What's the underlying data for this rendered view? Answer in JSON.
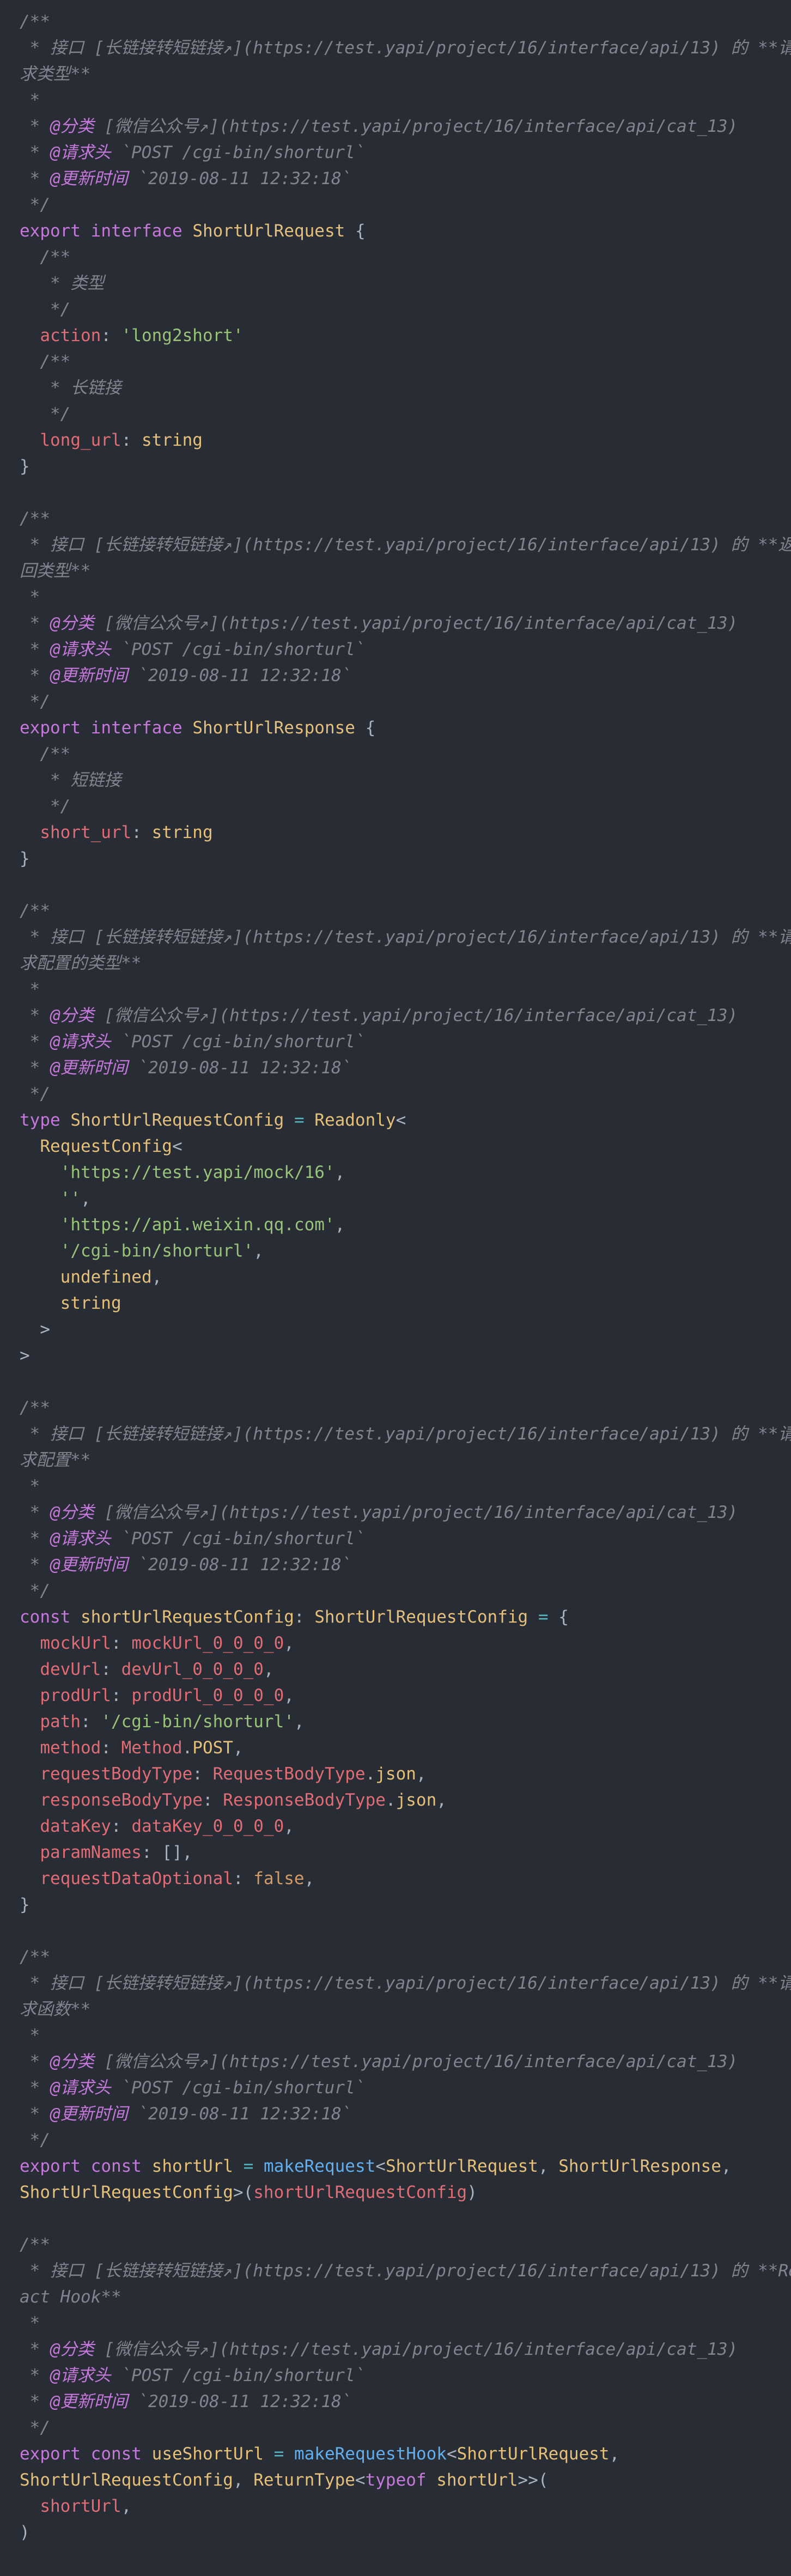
{
  "theme": {
    "background": "#282c34",
    "default": "#abb2bf",
    "comment": "#7f848e",
    "keyword": "#c678dd",
    "type": "#e5c07b",
    "property": "#e06c75",
    "string": "#98c379",
    "function": "#61afef",
    "operator": "#56b6c2",
    "literal": "#d19a66"
  },
  "lines": [
    [
      [
        "c",
        "/**"
      ]
    ],
    [
      [
        "c",
        " * 接口 [长链接转短链接↗](https://test.yapi/project/16/interface/api/13) 的 **请"
      ]
    ],
    [
      [
        "c",
        "求类型**"
      ]
    ],
    [
      [
        "c",
        " *"
      ]
    ],
    [
      [
        "c",
        " * "
      ],
      [
        "tg",
        "@分类"
      ],
      [
        "c",
        " [微信公众号↗](https://test.yapi/project/16/interface/api/cat_13)"
      ]
    ],
    [
      [
        "c",
        " * "
      ],
      [
        "tg",
        "@请求头"
      ],
      [
        "c",
        " `POST /cgi-bin/shorturl`"
      ]
    ],
    [
      [
        "c",
        " * "
      ],
      [
        "tg",
        "@更新时间"
      ],
      [
        "c",
        " `2019-08-11 12:32:18`"
      ]
    ],
    [
      [
        "c",
        " */"
      ]
    ],
    [
      [
        "kw",
        "export"
      ],
      [
        "pu",
        " "
      ],
      [
        "kw",
        "interface"
      ],
      [
        "pu",
        " "
      ],
      [
        "ty",
        "ShortUrlRequest"
      ],
      [
        "pu",
        " {"
      ]
    ],
    [
      [
        "c",
        "  /**"
      ]
    ],
    [
      [
        "c",
        "   * 类型"
      ]
    ],
    [
      [
        "c",
        "   */"
      ]
    ],
    [
      [
        "pu",
        "  "
      ],
      [
        "pr",
        "action"
      ],
      [
        "pu",
        ": "
      ],
      [
        "st",
        "'long2short'"
      ]
    ],
    [
      [
        "c",
        "  /**"
      ]
    ],
    [
      [
        "c",
        "   * 长链接"
      ]
    ],
    [
      [
        "c",
        "   */"
      ]
    ],
    [
      [
        "pu",
        "  "
      ],
      [
        "pr",
        "long_url"
      ],
      [
        "pu",
        ": "
      ],
      [
        "ty",
        "string"
      ]
    ],
    [
      [
        "pu",
        "}"
      ]
    ],
    [],
    [
      [
        "c",
        "/**"
      ]
    ],
    [
      [
        "c",
        " * 接口 [长链接转短链接↗](https://test.yapi/project/16/interface/api/13) 的 **返"
      ]
    ],
    [
      [
        "c",
        "回类型**"
      ]
    ],
    [
      [
        "c",
        " *"
      ]
    ],
    [
      [
        "c",
        " * "
      ],
      [
        "tg",
        "@分类"
      ],
      [
        "c",
        " [微信公众号↗](https://test.yapi/project/16/interface/api/cat_13)"
      ]
    ],
    [
      [
        "c",
        " * "
      ],
      [
        "tg",
        "@请求头"
      ],
      [
        "c",
        " `POST /cgi-bin/shorturl`"
      ]
    ],
    [
      [
        "c",
        " * "
      ],
      [
        "tg",
        "@更新时间"
      ],
      [
        "c",
        " `2019-08-11 12:32:18`"
      ]
    ],
    [
      [
        "c",
        " */"
      ]
    ],
    [
      [
        "kw",
        "export"
      ],
      [
        "pu",
        " "
      ],
      [
        "kw",
        "interface"
      ],
      [
        "pu",
        " "
      ],
      [
        "ty",
        "ShortUrlResponse"
      ],
      [
        "pu",
        " {"
      ]
    ],
    [
      [
        "c",
        "  /**"
      ]
    ],
    [
      [
        "c",
        "   * 短链接"
      ]
    ],
    [
      [
        "c",
        "   */"
      ]
    ],
    [
      [
        "pu",
        "  "
      ],
      [
        "pr",
        "short_url"
      ],
      [
        "pu",
        ": "
      ],
      [
        "ty",
        "string"
      ]
    ],
    [
      [
        "pu",
        "}"
      ]
    ],
    [],
    [
      [
        "c",
        "/**"
      ]
    ],
    [
      [
        "c",
        " * 接口 [长链接转短链接↗](https://test.yapi/project/16/interface/api/13) 的 **请"
      ]
    ],
    [
      [
        "c",
        "求配置的类型**"
      ]
    ],
    [
      [
        "c",
        " *"
      ]
    ],
    [
      [
        "c",
        " * "
      ],
      [
        "tg",
        "@分类"
      ],
      [
        "c",
        " [微信公众号↗](https://test.yapi/project/16/interface/api/cat_13)"
      ]
    ],
    [
      [
        "c",
        " * "
      ],
      [
        "tg",
        "@请求头"
      ],
      [
        "c",
        " `POST /cgi-bin/shorturl`"
      ]
    ],
    [
      [
        "c",
        " * "
      ],
      [
        "tg",
        "@更新时间"
      ],
      [
        "c",
        " `2019-08-11 12:32:18`"
      ]
    ],
    [
      [
        "c",
        " */"
      ]
    ],
    [
      [
        "kw",
        "type"
      ],
      [
        "pu",
        " "
      ],
      [
        "ty",
        "ShortUrlRequestConfig"
      ],
      [
        "pu",
        " "
      ],
      [
        "op",
        "="
      ],
      [
        "pu",
        " "
      ],
      [
        "ty",
        "Readonly"
      ],
      [
        "pu",
        "<"
      ]
    ],
    [
      [
        "pu",
        "  "
      ],
      [
        "ty",
        "RequestConfig"
      ],
      [
        "pu",
        "<"
      ]
    ],
    [
      [
        "pu",
        "    "
      ],
      [
        "st",
        "'https://test.yapi/mock/16'"
      ],
      [
        "pu",
        ","
      ]
    ],
    [
      [
        "pu",
        "    "
      ],
      [
        "st",
        "''"
      ],
      [
        "pu",
        ","
      ]
    ],
    [
      [
        "pu",
        "    "
      ],
      [
        "st",
        "'https://api.weixin.qq.com'"
      ],
      [
        "pu",
        ","
      ]
    ],
    [
      [
        "pu",
        "    "
      ],
      [
        "st",
        "'/cgi-bin/shorturl'"
      ],
      [
        "pu",
        ","
      ]
    ],
    [
      [
        "pu",
        "    "
      ],
      [
        "ty",
        "undefined"
      ],
      [
        "pu",
        ","
      ]
    ],
    [
      [
        "pu",
        "    "
      ],
      [
        "ty",
        "string"
      ]
    ],
    [
      [
        "pu",
        "  >"
      ]
    ],
    [
      [
        "pu",
        ">"
      ]
    ],
    [],
    [
      [
        "c",
        "/**"
      ]
    ],
    [
      [
        "c",
        " * 接口 [长链接转短链接↗](https://test.yapi/project/16/interface/api/13) 的 **请"
      ]
    ],
    [
      [
        "c",
        "求配置**"
      ]
    ],
    [
      [
        "c",
        " *"
      ]
    ],
    [
      [
        "c",
        " * "
      ],
      [
        "tg",
        "@分类"
      ],
      [
        "c",
        " [微信公众号↗](https://test.yapi/project/16/interface/api/cat_13)"
      ]
    ],
    [
      [
        "c",
        " * "
      ],
      [
        "tg",
        "@请求头"
      ],
      [
        "c",
        " `POST /cgi-bin/shorturl`"
      ]
    ],
    [
      [
        "c",
        " * "
      ],
      [
        "tg",
        "@更新时间"
      ],
      [
        "c",
        " `2019-08-11 12:32:18`"
      ]
    ],
    [
      [
        "c",
        " */"
      ]
    ],
    [
      [
        "kw",
        "const"
      ],
      [
        "pu",
        " "
      ],
      [
        "ty",
        "shortUrlRequestConfig"
      ],
      [
        "pu",
        ": "
      ],
      [
        "ty",
        "ShortUrlRequestConfig"
      ],
      [
        "pu",
        " "
      ],
      [
        "op",
        "="
      ],
      [
        "pu",
        " {"
      ]
    ],
    [
      [
        "pu",
        "  "
      ],
      [
        "pr",
        "mockUrl"
      ],
      [
        "pu",
        ": "
      ],
      [
        "pr",
        "mockUrl_0_0_0_0"
      ],
      [
        "pu",
        ","
      ]
    ],
    [
      [
        "pu",
        "  "
      ],
      [
        "pr",
        "devUrl"
      ],
      [
        "pu",
        ": "
      ],
      [
        "pr",
        "devUrl_0_0_0_0"
      ],
      [
        "pu",
        ","
      ]
    ],
    [
      [
        "pu",
        "  "
      ],
      [
        "pr",
        "prodUrl"
      ],
      [
        "pu",
        ": "
      ],
      [
        "pr",
        "prodUrl_0_0_0_0"
      ],
      [
        "pu",
        ","
      ]
    ],
    [
      [
        "pu",
        "  "
      ],
      [
        "pr",
        "path"
      ],
      [
        "pu",
        ": "
      ],
      [
        "st",
        "'/cgi-bin/shorturl'"
      ],
      [
        "pu",
        ","
      ]
    ],
    [
      [
        "pu",
        "  "
      ],
      [
        "pr",
        "method"
      ],
      [
        "pu",
        ": "
      ],
      [
        "pr",
        "Method"
      ],
      [
        "pu",
        "."
      ],
      [
        "ty",
        "POST"
      ],
      [
        "pu",
        ","
      ]
    ],
    [
      [
        "pu",
        "  "
      ],
      [
        "pr",
        "requestBodyType"
      ],
      [
        "pu",
        ": "
      ],
      [
        "pr",
        "RequestBodyType"
      ],
      [
        "pu",
        "."
      ],
      [
        "ty",
        "json"
      ],
      [
        "pu",
        ","
      ]
    ],
    [
      [
        "pu",
        "  "
      ],
      [
        "pr",
        "responseBodyType"
      ],
      [
        "pu",
        ": "
      ],
      [
        "pr",
        "ResponseBodyType"
      ],
      [
        "pu",
        "."
      ],
      [
        "ty",
        "json"
      ],
      [
        "pu",
        ","
      ]
    ],
    [
      [
        "pu",
        "  "
      ],
      [
        "pr",
        "dataKey"
      ],
      [
        "pu",
        ": "
      ],
      [
        "pr",
        "dataKey_0_0_0_0"
      ],
      [
        "pu",
        ","
      ]
    ],
    [
      [
        "pu",
        "  "
      ],
      [
        "pr",
        "paramNames"
      ],
      [
        "pu",
        ": [],"
      ]
    ],
    [
      [
        "pu",
        "  "
      ],
      [
        "pr",
        "requestDataOptional"
      ],
      [
        "pu",
        ": "
      ],
      [
        "nu",
        "false"
      ],
      [
        "pu",
        ","
      ]
    ],
    [
      [
        "pu",
        "}"
      ]
    ],
    [],
    [
      [
        "c",
        "/**"
      ]
    ],
    [
      [
        "c",
        " * 接口 [长链接转短链接↗](https://test.yapi/project/16/interface/api/13) 的 **请"
      ]
    ],
    [
      [
        "c",
        "求函数**"
      ]
    ],
    [
      [
        "c",
        " *"
      ]
    ],
    [
      [
        "c",
        " * "
      ],
      [
        "tg",
        "@分类"
      ],
      [
        "c",
        " [微信公众号↗](https://test.yapi/project/16/interface/api/cat_13)"
      ]
    ],
    [
      [
        "c",
        " * "
      ],
      [
        "tg",
        "@请求头"
      ],
      [
        "c",
        " `POST /cgi-bin/shorturl`"
      ]
    ],
    [
      [
        "c",
        " * "
      ],
      [
        "tg",
        "@更新时间"
      ],
      [
        "c",
        " `2019-08-11 12:32:18`"
      ]
    ],
    [
      [
        "c",
        " */"
      ]
    ],
    [
      [
        "kw",
        "export"
      ],
      [
        "pu",
        " "
      ],
      [
        "kw",
        "const"
      ],
      [
        "pu",
        " "
      ],
      [
        "ty",
        "shortUrl"
      ],
      [
        "pu",
        " "
      ],
      [
        "op",
        "="
      ],
      [
        "pu",
        " "
      ],
      [
        "fn",
        "makeRequest"
      ],
      [
        "pu",
        "<"
      ],
      [
        "ty",
        "ShortUrlRequest"
      ],
      [
        "pu",
        ", "
      ],
      [
        "ty",
        "ShortUrlResponse"
      ],
      [
        "pu",
        ","
      ]
    ],
    [
      [
        "ty",
        "ShortUrlRequestConfig"
      ],
      [
        "pu",
        ">("
      ],
      [
        "pr",
        "shortUrlRequestConfig"
      ],
      [
        "pu",
        ")"
      ]
    ],
    [],
    [
      [
        "c",
        "/**"
      ]
    ],
    [
      [
        "c",
        " * 接口 [长链接转短链接↗](https://test.yapi/project/16/interface/api/13) 的 **Re"
      ]
    ],
    [
      [
        "c",
        "act Hook**"
      ]
    ],
    [
      [
        "c",
        " *"
      ]
    ],
    [
      [
        "c",
        " * "
      ],
      [
        "tg",
        "@分类"
      ],
      [
        "c",
        " [微信公众号↗](https://test.yapi/project/16/interface/api/cat_13)"
      ]
    ],
    [
      [
        "c",
        " * "
      ],
      [
        "tg",
        "@请求头"
      ],
      [
        "c",
        " `POST /cgi-bin/shorturl`"
      ]
    ],
    [
      [
        "c",
        " * "
      ],
      [
        "tg",
        "@更新时间"
      ],
      [
        "c",
        " `2019-08-11 12:32:18`"
      ]
    ],
    [
      [
        "c",
        " */"
      ]
    ],
    [
      [
        "kw",
        "export"
      ],
      [
        "pu",
        " "
      ],
      [
        "kw",
        "const"
      ],
      [
        "pu",
        " "
      ],
      [
        "ty",
        "useShortUrl"
      ],
      [
        "pu",
        " "
      ],
      [
        "op",
        "="
      ],
      [
        "pu",
        " "
      ],
      [
        "fn",
        "makeRequestHook"
      ],
      [
        "pu",
        "<"
      ],
      [
        "ty",
        "ShortUrlRequest"
      ],
      [
        "pu",
        ","
      ]
    ],
    [
      [
        "ty",
        "ShortUrlRequestConfig"
      ],
      [
        "pu",
        ", "
      ],
      [
        "ty",
        "ReturnType"
      ],
      [
        "pu",
        "<"
      ],
      [
        "kw",
        "typeof"
      ],
      [
        "pu",
        " "
      ],
      [
        "ty",
        "shortUrl"
      ],
      [
        "pu",
        ">>("
      ]
    ],
    [
      [
        "pu",
        "  "
      ],
      [
        "pr",
        "shortUrl"
      ],
      [
        "pu",
        ","
      ]
    ],
    [
      [
        "pu",
        ")"
      ]
    ]
  ]
}
